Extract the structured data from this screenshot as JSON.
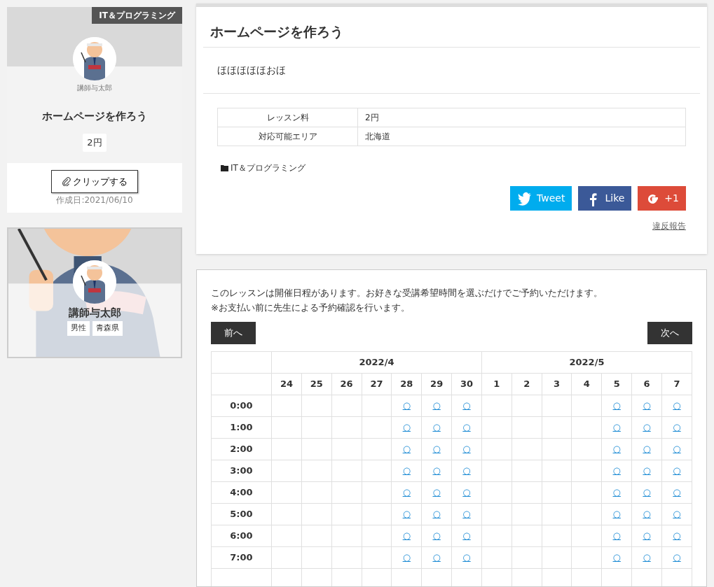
{
  "sidebar_lesson_card": {
    "category_badge": "IT＆プログラミング",
    "teacher_name": "講師与太郎",
    "title": "ホームページを作ろう",
    "price": "2円",
    "clip_button": "クリップする",
    "created": "作成日:2021/06/10"
  },
  "teacher_card": {
    "name": "講師与太郎",
    "tags": [
      "男性",
      "青森県"
    ]
  },
  "lesson": {
    "title": "ホームページを作ろう",
    "description": "ほほほほほおほ",
    "details": [
      {
        "label": "レッスン料",
        "value": "2円"
      },
      {
        "label": "対応可能エリア",
        "value": "北海道"
      }
    ],
    "category": "IT＆プログラミング",
    "share_buttons": [
      {
        "kind": "twitter",
        "label": "Tweet"
      },
      {
        "kind": "facebook",
        "label": "Like"
      },
      {
        "kind": "google",
        "label": "+1"
      }
    ],
    "report_link": "違反報告"
  },
  "schedule": {
    "notes": [
      "このレッスンは開催日程があります。お好きな受講希望時間を選ぶだけでご予約いただけます。",
      "※お支払い前に先生による予約確認を行います。"
    ],
    "prev_button": "前へ",
    "next_button": "次へ",
    "months": [
      {
        "label": "2022/4",
        "days": [
          "24",
          "25",
          "26",
          "27",
          "28",
          "29",
          "30"
        ]
      },
      {
        "label": "2022/5",
        "days": [
          "1",
          "2",
          "3",
          "4",
          "5",
          "6",
          "7"
        ]
      }
    ],
    "rows": [
      {
        "time": "0:00",
        "cells": [
          null,
          null,
          null,
          null,
          "○",
          "○",
          "○",
          null,
          null,
          null,
          null,
          "○",
          "○",
          "○"
        ]
      },
      {
        "time": "1:00",
        "cells": [
          null,
          null,
          null,
          null,
          "○",
          "○",
          "○",
          null,
          null,
          null,
          null,
          "○",
          "○",
          "○"
        ]
      },
      {
        "time": "2:00",
        "cells": [
          null,
          null,
          null,
          null,
          "○",
          "○",
          "○",
          null,
          null,
          null,
          null,
          "○",
          "○",
          "○"
        ]
      },
      {
        "time": "3:00",
        "cells": [
          null,
          null,
          null,
          null,
          "○",
          "○",
          "○",
          null,
          null,
          null,
          null,
          "○",
          "○",
          "○"
        ]
      },
      {
        "time": "4:00",
        "cells": [
          null,
          null,
          null,
          null,
          "○",
          "○",
          "○",
          null,
          null,
          null,
          null,
          "○",
          "○",
          "○"
        ]
      },
      {
        "time": "5:00",
        "cells": [
          null,
          null,
          null,
          null,
          "○",
          "○",
          "○",
          null,
          null,
          null,
          null,
          "○",
          "○",
          "○"
        ]
      },
      {
        "time": "6:00",
        "cells": [
          null,
          null,
          null,
          null,
          "○",
          "○",
          "○",
          null,
          null,
          null,
          null,
          "○",
          "○",
          "○"
        ]
      },
      {
        "time": "7:00",
        "cells": [
          null,
          null,
          null,
          null,
          "○",
          "○",
          "○",
          null,
          null,
          null,
          null,
          "○",
          "○",
          "○"
        ]
      }
    ]
  }
}
